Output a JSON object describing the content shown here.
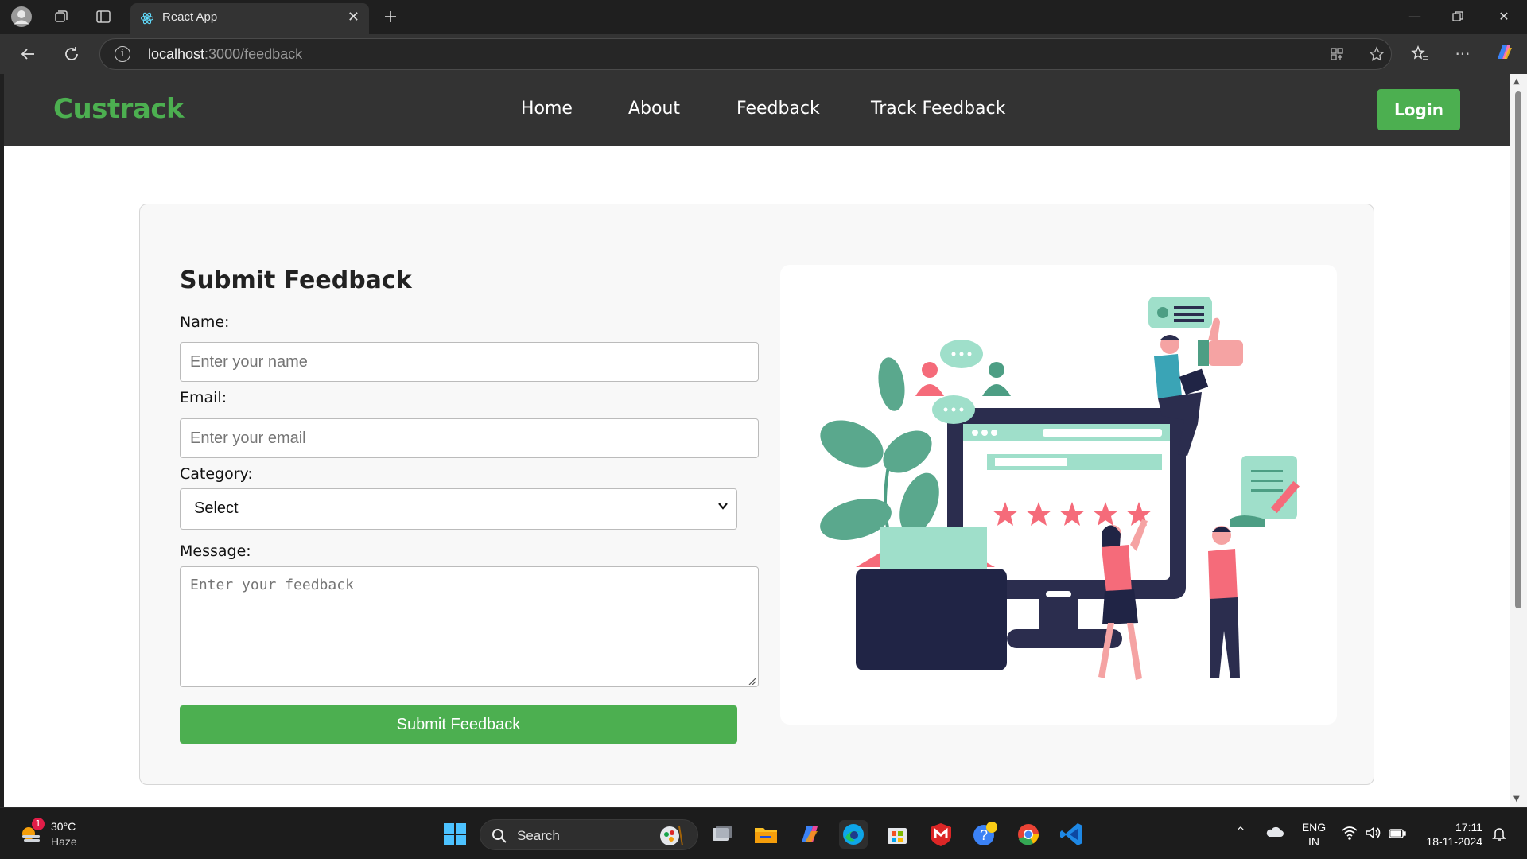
{
  "browser": {
    "tab_title": "React App",
    "url_host": "localhost",
    "url_path": ":3000/feedback"
  },
  "navbar": {
    "brand": "Custrack",
    "links": [
      "Home",
      "About",
      "Feedback",
      "Track Feedback"
    ],
    "login_label": "Login"
  },
  "form": {
    "title": "Submit Feedback",
    "name_label": "Name:",
    "name_placeholder": "Enter your name",
    "email_label": "Email:",
    "email_placeholder": "Enter your email",
    "category_label": "Category:",
    "category_value": "Select",
    "message_label": "Message:",
    "message_placeholder": "Enter your feedback",
    "submit_label": "Submit Feedback"
  },
  "colors": {
    "brand": "#4caf50",
    "navbar_bg": "#333333",
    "illustration_coral": "#f56b7a",
    "illustration_mint": "#9fdfca",
    "illustration_navy": "#2b2d4e"
  },
  "taskbar": {
    "weather_temp": "30°C",
    "weather_desc": "Haze",
    "weather_badge": "1",
    "search_label": "Search",
    "lang_top": "ENG",
    "lang_bottom": "IN",
    "time": "17:11",
    "date": "18-11-2024"
  }
}
